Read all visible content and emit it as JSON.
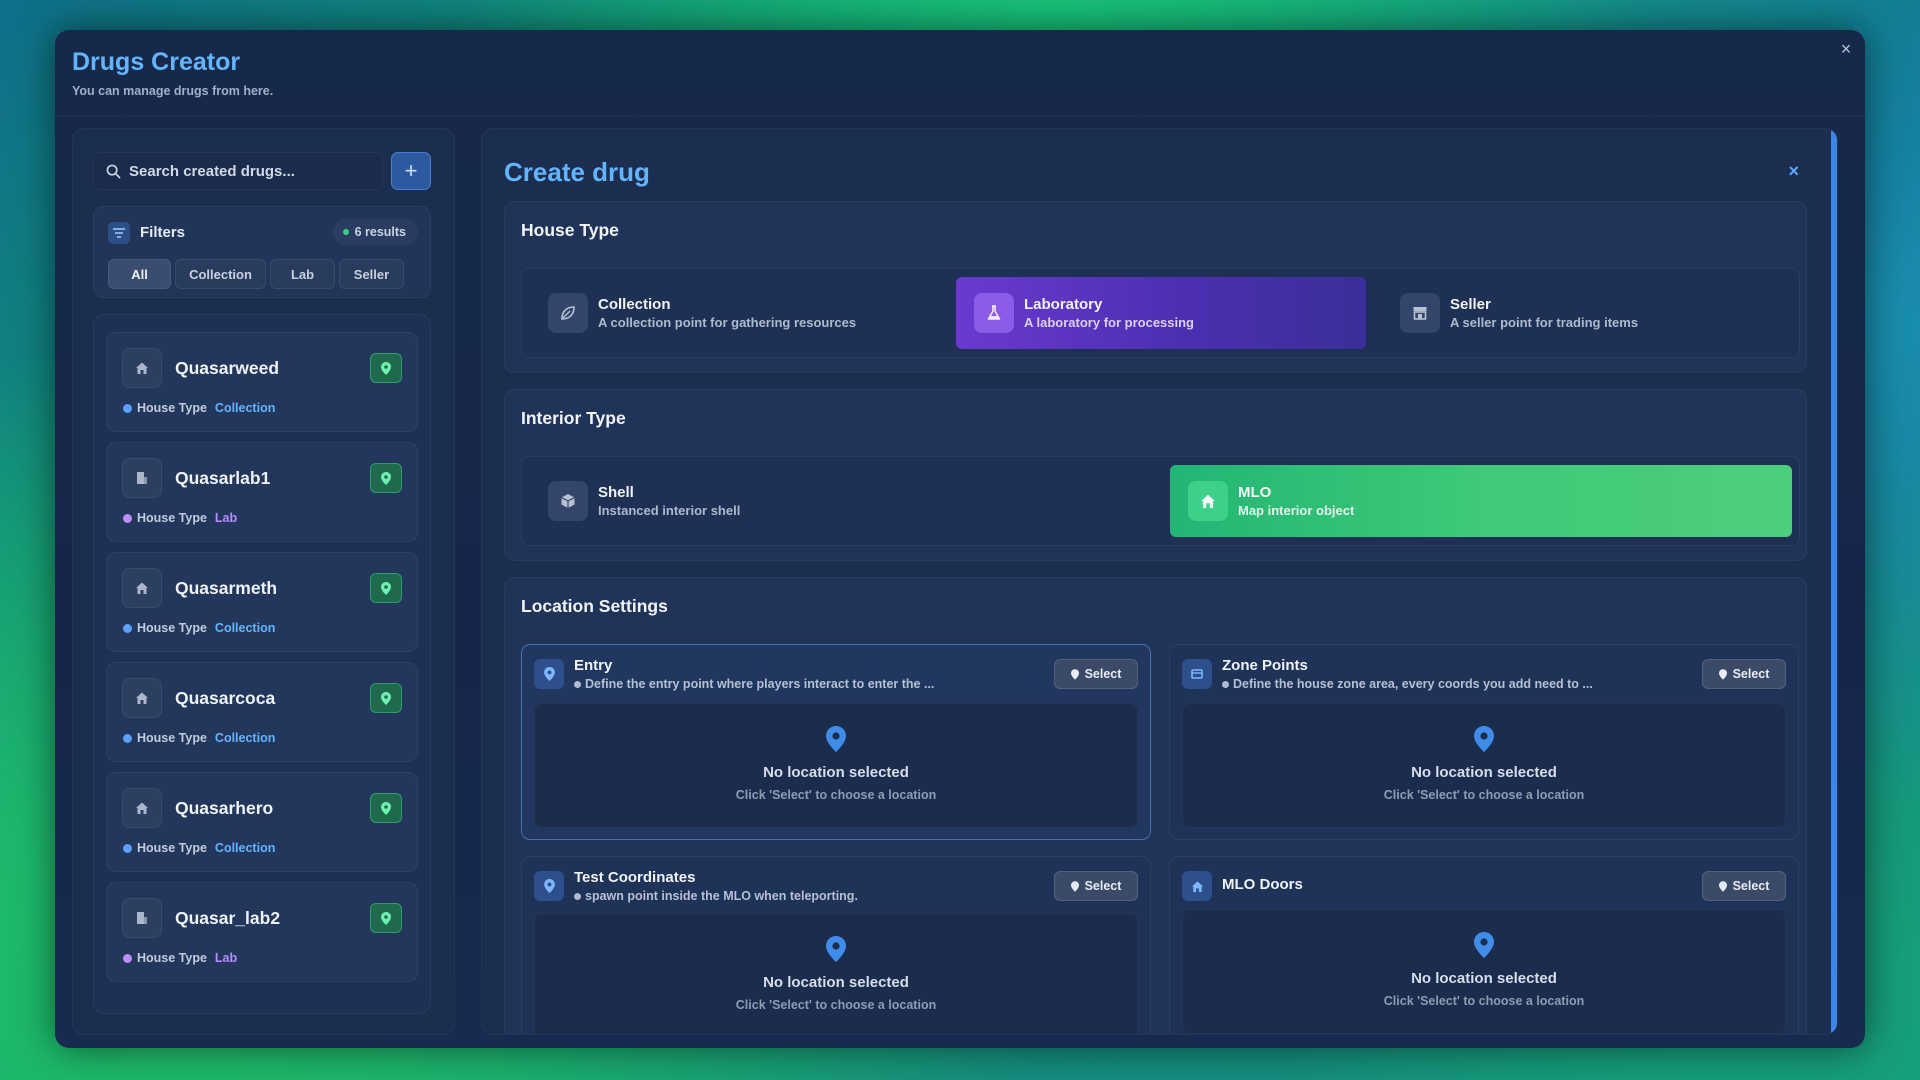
{
  "window": {
    "title": "Drugs Creator",
    "subtitle": "You can manage drugs from here.",
    "close": "×"
  },
  "sidebar": {
    "search_placeholder": "Search created drugs...",
    "add_label": "+",
    "filters": {
      "label": "Filters",
      "results": "6 results",
      "tabs": [
        "All",
        "Collection",
        "Lab",
        "Seller"
      ],
      "active_tab": "All"
    },
    "type_prefix": "House Type",
    "drugs": [
      {
        "name": "Quasarweed",
        "type": "Collection",
        "icon": "home-icon"
      },
      {
        "name": "Quasarlab1",
        "type": "Lab",
        "icon": "building-icon"
      },
      {
        "name": "Quasarmeth",
        "type": "Collection",
        "icon": "home-icon"
      },
      {
        "name": "Quasarcoca",
        "type": "Collection",
        "icon": "home-icon"
      },
      {
        "name": "Quasarhero",
        "type": "Collection",
        "icon": "home-icon"
      },
      {
        "name": "Quasar_lab2",
        "type": "Lab",
        "icon": "building-icon"
      }
    ]
  },
  "main": {
    "title": "Create drug",
    "close": "×",
    "house_type": {
      "title": "House Type",
      "selected": "Laboratory",
      "options": [
        {
          "title": "Collection",
          "desc": "A collection point for gathering resources",
          "icon": "leaf-icon"
        },
        {
          "title": "Laboratory",
          "desc": "A laboratory for processing",
          "icon": "flask-icon"
        },
        {
          "title": "Seller",
          "desc": "A seller point for trading items",
          "icon": "store-icon"
        }
      ]
    },
    "interior_type": {
      "title": "Interior Type",
      "selected": "MLO",
      "options": [
        {
          "title": "Shell",
          "desc": "Instanced interior shell",
          "icon": "cube-icon"
        },
        {
          "title": "MLO",
          "desc": "Map interior object",
          "icon": "home-icon"
        }
      ]
    },
    "location_settings": {
      "title": "Location Settings",
      "select_label": "Select",
      "empty_title": "No location selected",
      "empty_hint": "Click 'Select' to choose a location",
      "cards": [
        {
          "title": "Entry",
          "desc": "Define the entry point where players interact to enter the ...",
          "icon": "pin-icon"
        },
        {
          "title": "Zone Points",
          "desc": "Define the house zone area, every coords you add need to ...",
          "icon": "zone-icon"
        },
        {
          "title": "Test Coordinates",
          "desc": "spawn point inside the MLO when teleporting.",
          "icon": "pin-icon"
        },
        {
          "title": "MLO Doors",
          "desc": "",
          "icon": "home-icon"
        }
      ]
    }
  },
  "colors": {
    "accent": "#63b4ff",
    "lab_selected": "#6a3ad0",
    "mlo_selected": "#3fc978",
    "collection_type": "#63b4ff",
    "lab_type": "#b98cff"
  }
}
